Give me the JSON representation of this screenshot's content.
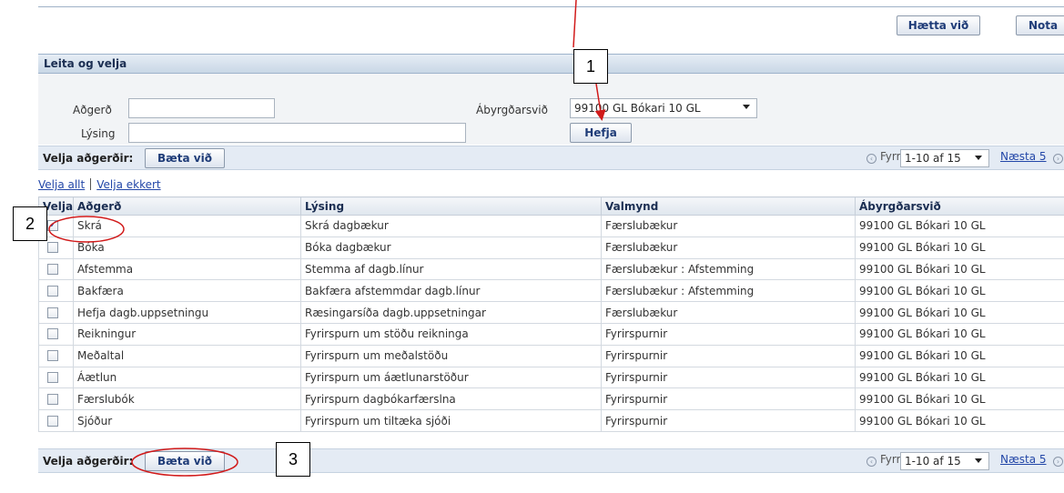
{
  "top_buttons": {
    "cancel": "Hætta við",
    "apply": "Nota"
  },
  "section": {
    "title": "Leita og velja"
  },
  "search": {
    "action_label": "Aðgerð",
    "action_value": "",
    "description_label": "Lýsing",
    "description_value": "",
    "responsibility_label": "Ábyrgðarsvið",
    "responsibility_value": "99100 GL Bókari 10 GL",
    "go_button": "Hefja"
  },
  "action_bar": {
    "label": "Velja aðgerðir:",
    "add_button": "Bæta við",
    "prev": "Fyrra",
    "range": "1-10 af 15",
    "next": "Næsta 5"
  },
  "select_links": {
    "select_all": "Velja allt",
    "select_none": "Velja ekkert"
  },
  "table": {
    "columns": [
      "Velja",
      "Aðgerð",
      "Lýsing",
      "Valmynd",
      "Ábyrgðarsvið"
    ],
    "rows": [
      {
        "checked": true,
        "action": "Skrá",
        "description": "Skrá dagbækur",
        "menu": "Færslubækur",
        "responsibility": "99100 GL Bókari 10 GL"
      },
      {
        "checked": false,
        "action": "Bóka",
        "description": "Bóka dagbækur",
        "menu": "Færslubækur",
        "responsibility": "99100 GL Bókari 10 GL"
      },
      {
        "checked": false,
        "action": "Afstemma",
        "description": "Stemma af dagb.línur",
        "menu": "Færslubækur : Afstemming",
        "responsibility": "99100 GL Bókari 10 GL"
      },
      {
        "checked": false,
        "action": "Bakfæra",
        "description": "Bakfæra afstemmdar dagb.línur",
        "menu": "Færslubækur : Afstemming",
        "responsibility": "99100 GL Bókari 10 GL"
      },
      {
        "checked": false,
        "action": "Hefja dagb.uppsetningu",
        "description": "Ræsingarsíða dagb.uppsetningar",
        "menu": "Færslubækur",
        "responsibility": "99100 GL Bókari 10 GL"
      },
      {
        "checked": false,
        "action": "Reikningur",
        "description": "Fyrirspurn um stöðu reikninga",
        "menu": "Fyrirspurnir",
        "responsibility": "99100 GL Bókari 10 GL"
      },
      {
        "checked": false,
        "action": "Meðaltal",
        "description": "Fyrirspurn um meðalstöðu",
        "menu": "Fyrirspurnir",
        "responsibility": "99100 GL Bókari 10 GL"
      },
      {
        "checked": false,
        "action": "Áætlun",
        "description": "Fyrirspurn um áætlunarstöður",
        "menu": "Fyrirspurnir",
        "responsibility": "99100 GL Bókari 10 GL"
      },
      {
        "checked": false,
        "action": "Færslubók",
        "description": "Fyrirspurn dagbókarfærslna",
        "menu": "Fyrirspurnir",
        "responsibility": "99100 GL Bókari 10 GL"
      },
      {
        "checked": false,
        "action": "Sjóður",
        "description": "Fyrirspurn um tiltæka sjóði",
        "menu": "Fyrirspurnir",
        "responsibility": "99100 GL Bókari 10 GL"
      }
    ]
  },
  "callouts": [
    "1",
    "2",
    "3"
  ],
  "annotation_color": "#d11a1a"
}
